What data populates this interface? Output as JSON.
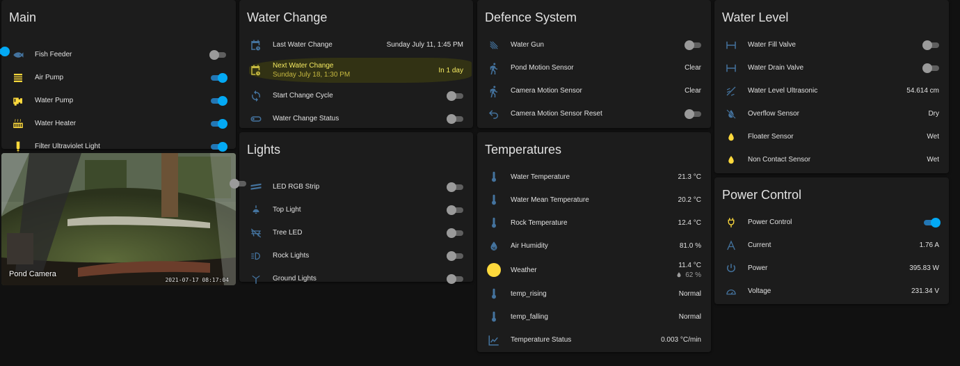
{
  "main": {
    "title": "Main",
    "master_on": true,
    "items": [
      {
        "label": "Fish Feeder",
        "icon": "fish-icon",
        "on": false
      },
      {
        "label": "Air Pump",
        "icon": "air-filter-icon",
        "on": true
      },
      {
        "label": "Water Pump",
        "icon": "water-pump-icon",
        "on": true
      },
      {
        "label": "Water Heater",
        "icon": "radiator-icon",
        "on": true
      },
      {
        "label": "Filter Ultraviolet Light",
        "icon": "lightbulb-icon",
        "on": true
      }
    ]
  },
  "camera": {
    "label": "Pond Camera",
    "timestamp": "2021-07-17  08:17:04"
  },
  "water_change": {
    "title": "Water Change",
    "last_label": "Last Water Change",
    "last_value": "Sunday July 11, 1:45 PM",
    "next_label": "Next Water Change",
    "next_date": "Sunday July 18, 1:30 PM",
    "next_value": "In 1 day",
    "start_label": "Start Change Cycle",
    "status_label": "Water Change Status"
  },
  "lights": {
    "title": "Lights",
    "items": [
      {
        "label": "LED RGB Strip",
        "icon": "led-strip-icon"
      },
      {
        "label": "Top Light",
        "icon": "ceiling-light-icon"
      },
      {
        "label": "Tree LED",
        "icon": "tree-led-icon"
      },
      {
        "label": "Rock Lights",
        "icon": "light-beam-icon"
      },
      {
        "label": "Ground Lights",
        "icon": "garden-light-icon"
      }
    ]
  },
  "defence": {
    "title": "Defence System",
    "items": [
      {
        "label": "Water Gun",
        "type": "toggle"
      },
      {
        "label": "Pond Motion Sensor",
        "type": "value",
        "value": "Clear"
      },
      {
        "label": "Camera Motion Sensor",
        "type": "value",
        "value": "Clear"
      },
      {
        "label": "Camera Motion Sensor Reset",
        "type": "toggle"
      }
    ]
  },
  "temps": {
    "title": "Temperatures",
    "water": {
      "label": "Water Temperature",
      "value": "21.3 °C"
    },
    "water_mean": {
      "label": "Water Mean Temperature",
      "value": "20.2 °C"
    },
    "rock": {
      "label": "Rock Temperature",
      "value": "12.4 °C"
    },
    "humidity": {
      "label": "Air Humidity",
      "value": "81.0 %"
    },
    "weather": {
      "label": "Weather",
      "temp": "11.4 °C",
      "humidity": "62 %"
    },
    "rising": {
      "label": "temp_rising",
      "value": "Normal"
    },
    "falling": {
      "label": "temp_falling",
      "value": "Normal"
    },
    "status": {
      "label": "Temperature Status",
      "value": "0.003 °C/min"
    }
  },
  "water_level": {
    "title": "Water Level",
    "fill": {
      "label": "Water Fill Valve"
    },
    "drain": {
      "label": "Water Drain Valve"
    },
    "ultrasonic": {
      "label": "Water Level Ultrasonic",
      "value": "54.614 cm"
    },
    "overflow": {
      "label": "Overflow Sensor",
      "value": "Dry"
    },
    "floater": {
      "label": "Floater Sensor",
      "value": "Wet"
    },
    "noncontact": {
      "label": "Non Contact Sensor",
      "value": "Wet"
    }
  },
  "power": {
    "title": "Power Control",
    "control": {
      "label": "Power Control"
    },
    "current": {
      "label": "Current",
      "value": "1.76 A"
    },
    "power": {
      "label": "Power",
      "value": "395.83 W"
    },
    "voltage": {
      "label": "Voltage",
      "value": "231.34 V"
    }
  },
  "colors": {
    "icon": "#44739e",
    "toggle_on": "#03a9f4",
    "highlight_text": "#f6eb61",
    "sun": "#fdd93c",
    "drop": "#fdd93c"
  }
}
